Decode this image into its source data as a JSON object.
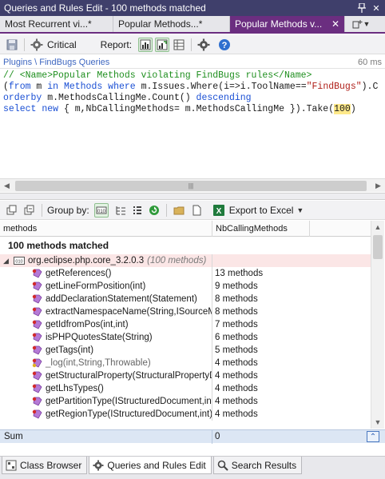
{
  "window": {
    "title": "Queries and Rules Edit  -  100 methods matched"
  },
  "doc_tabs": [
    {
      "label": "Most Recurrent vi...*"
    },
    {
      "label": "Popular Methods...*"
    },
    {
      "label": "Popular Methods v..."
    }
  ],
  "toolbar": {
    "critical_label": "Critical",
    "report_label": "Report:"
  },
  "breadcrumb": {
    "path": "Plugins \\ FindBugs Queries",
    "timing": "60 ms"
  },
  "query": {
    "line1_comment": "// <Name>Popular Methods violating FindBugs rules</Name>",
    "line2_kw1": "from",
    "line2_a": " m ",
    "line2_kw2": "in",
    "line2_b": " ",
    "line2_kw3": "Methods",
    "line2_c": " ",
    "line2_kw4": "where",
    "line2_d": " m.Issues.Where(i=>i.ToolName==",
    "line2_str": "\"FindBugs\"",
    "line2_e": ").C",
    "line3_kw": "orderby",
    "line3_a": " m.MethodsCallingMe.Count() ",
    "line3_kw2": "descending",
    "line4_kw1": "select",
    "line4_a": " ",
    "line4_kw2": "new",
    "line4_b": " { m,NbCallingMethods= m.MethodsCallingMe }).Take(",
    "line4_num": "100",
    "line4_c": ")"
  },
  "result_toolbar": {
    "group_by_label": "Group by:",
    "export_label": "Export to Excel"
  },
  "grid": {
    "columns": [
      "methods",
      "NbCallingMethods"
    ],
    "title": "100 methods matched",
    "group": {
      "name": "org.eclipse.php.core_3.2.0.3",
      "count": "(100 methods)"
    },
    "rows": [
      {
        "method": "getReferences()",
        "count": "13 methods",
        "muted": false
      },
      {
        "method": "getLineFormPosition(int)",
        "count": "9 methods",
        "muted": false
      },
      {
        "method": "addDeclarationStatement(Statement)",
        "count": "8 methods",
        "muted": false
      },
      {
        "method": "extractNamespaceName(String,ISourceModule)",
        "count": "8 methods",
        "muted": false
      },
      {
        "method": "getIdfromPos(int,int)",
        "count": "7 methods",
        "muted": false
      },
      {
        "method": "isPHPQuotesState(String)",
        "count": "6 methods",
        "muted": false
      },
      {
        "method": "getTags(int)",
        "count": "5 methods",
        "muted": false
      },
      {
        "method": "_log(int,String,Throwable)",
        "count": "4 methods",
        "muted": true
      },
      {
        "method": "getStructuralProperty(StructuralPropertyDescriptor)",
        "count": "4 methods",
        "muted": false
      },
      {
        "method": "getLhsTypes()",
        "count": "4 methods",
        "muted": false
      },
      {
        "method": "getPartitionType(IStructuredDocument,int,...)",
        "count": "4 methods",
        "muted": false
      },
      {
        "method": "getRegionType(IStructuredDocument,int)",
        "count": "4 methods",
        "muted": false
      }
    ]
  },
  "sum": {
    "label": "Sum",
    "value": "0"
  },
  "bottom_tabs": [
    {
      "label": "Class Browser"
    },
    {
      "label": "Queries and Rules Edit"
    },
    {
      "label": "Search Results"
    }
  ],
  "colors": {
    "title_bar": "#3f3f6b",
    "active_tab": "#6b2e80",
    "group_row": "#fbe6e6",
    "sum_row": "#dce6f4"
  }
}
